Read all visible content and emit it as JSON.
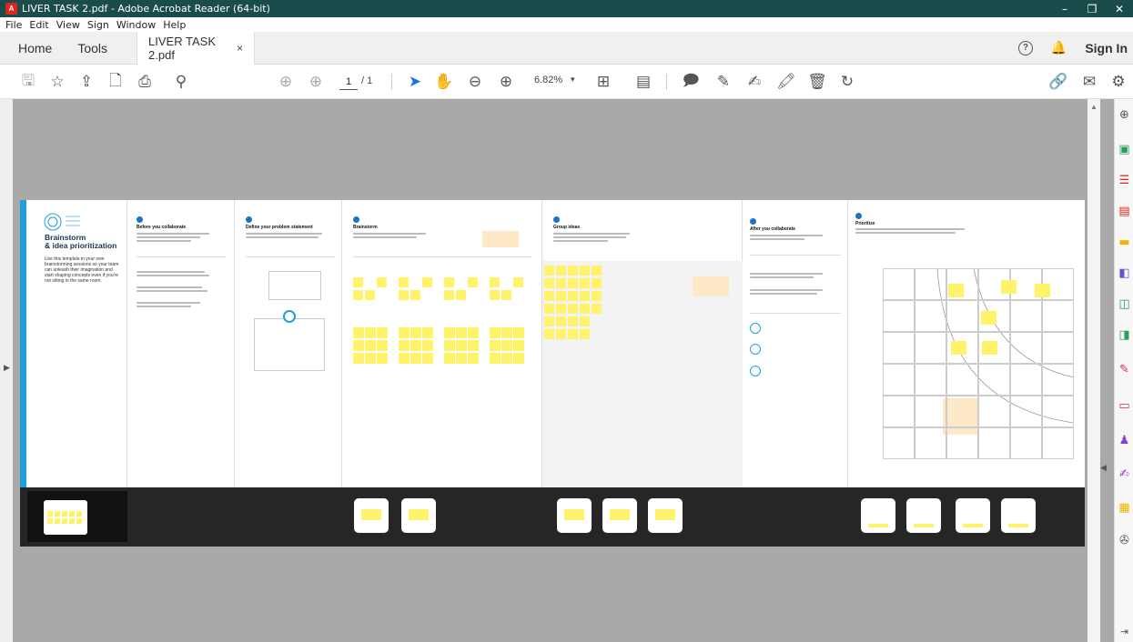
{
  "window": {
    "app_icon_letter": "A",
    "title": "LIVER TASK 2.pdf - Adobe Acrobat Reader (64-bit)",
    "minimize": "–",
    "maximize": "❐",
    "close": "✕"
  },
  "menu": [
    "File",
    "Edit",
    "View",
    "Sign",
    "Window",
    "Help"
  ],
  "tabs": {
    "home": "Home",
    "tools": "Tools",
    "document": "LIVER TASK 2.pdf",
    "close": "×",
    "help": "?",
    "notification": "🔔",
    "sign_in": "Sign In"
  },
  "toolbar": {
    "page_current": "1",
    "page_total": "/ 1",
    "zoom": "6.82%",
    "zoom_arrow": "▾",
    "icons": {
      "save": "🖫",
      "bookmark": "☆",
      "upload": "⇪",
      "create": "🗋",
      "print": "⎙",
      "search": "⚲",
      "prev": "⊕",
      "next": "⊕",
      "select": "➤",
      "hand": "✋",
      "zoom_out": "⊖",
      "zoom_in": "⊕",
      "fit": "⊞",
      "scroll": "▤",
      "comment": "🗩",
      "highlight": "✎",
      "sign": "✍",
      "stamp": "🖍",
      "delete": "🗑",
      "rotate": "↻",
      "share_link": "🔗",
      "email": "✉",
      "more": "⚙"
    }
  },
  "canvas": {
    "intro_title": "Brainstorm\n& idea prioritization",
    "intro_body": "Use this template in your own brainstorming sessions so your team can unleash their imagination and start shaping concepts even if you're not sitting in the same room.",
    "panels": [
      {
        "title": "Before you collaborate"
      },
      {
        "title": "Define your problem statement"
      },
      {
        "title": "Brainstorm"
      },
      {
        "title": "Group ideas"
      },
      {
        "title": "After you collaborate"
      },
      {
        "title": "Prioritize"
      }
    ]
  },
  "colors": {
    "titlebar": "#1a4c4c",
    "sticky": "#fff36b",
    "accent": "#1fa0db",
    "doc_bg": "#a9a9a9"
  }
}
